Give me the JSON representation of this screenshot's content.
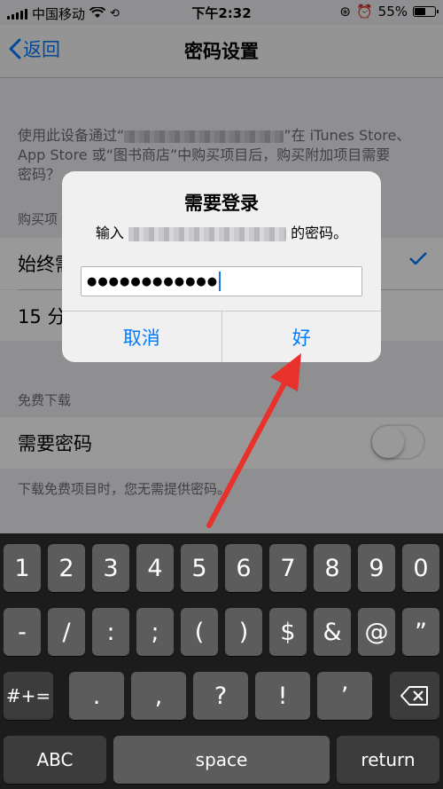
{
  "status_bar": {
    "carrier": "中国移动",
    "time": "下午2:32",
    "battery": "55%"
  },
  "nav": {
    "back": "返回",
    "title": "密码设置"
  },
  "settings": {
    "description_1": "使用此设备通过“",
    "description_2": "”在 iTunes Store、",
    "description_3": "App Store 或“图书商店”中购买项目后，购买附加项目需要",
    "description_4": "密码？",
    "purchase_section_label": "购买项",
    "option_always": "始终需",
    "option_15": "15 分",
    "free_section_label": "免费下载",
    "require_password": "需要密码",
    "require_password_on": false,
    "footnote": "下载免费项目时，您无需提供密码。"
  },
  "alert": {
    "title": "需要登录",
    "message_prefix": "输入",
    "message_suffix": "的密码。",
    "password_masked": "●●●●●●●●●●●●",
    "cancel": "取消",
    "ok": "好"
  },
  "keyboard": {
    "row1": [
      "1",
      "2",
      "3",
      "4",
      "5",
      "6",
      "7",
      "8",
      "9",
      "0"
    ],
    "row2": [
      "-",
      "/",
      ":",
      ";",
      "(",
      ")",
      "$",
      "&",
      "@",
      "”"
    ],
    "row3_left": "#+=",
    "row3": [
      ".",
      ",",
      "?",
      "!",
      "’"
    ],
    "abc": "ABC",
    "space": "space",
    "return": "return"
  },
  "colors": {
    "accent": "#007aff",
    "arrow": "#e8312a",
    "dim": "rgba(0,0,0,0.4)"
  }
}
